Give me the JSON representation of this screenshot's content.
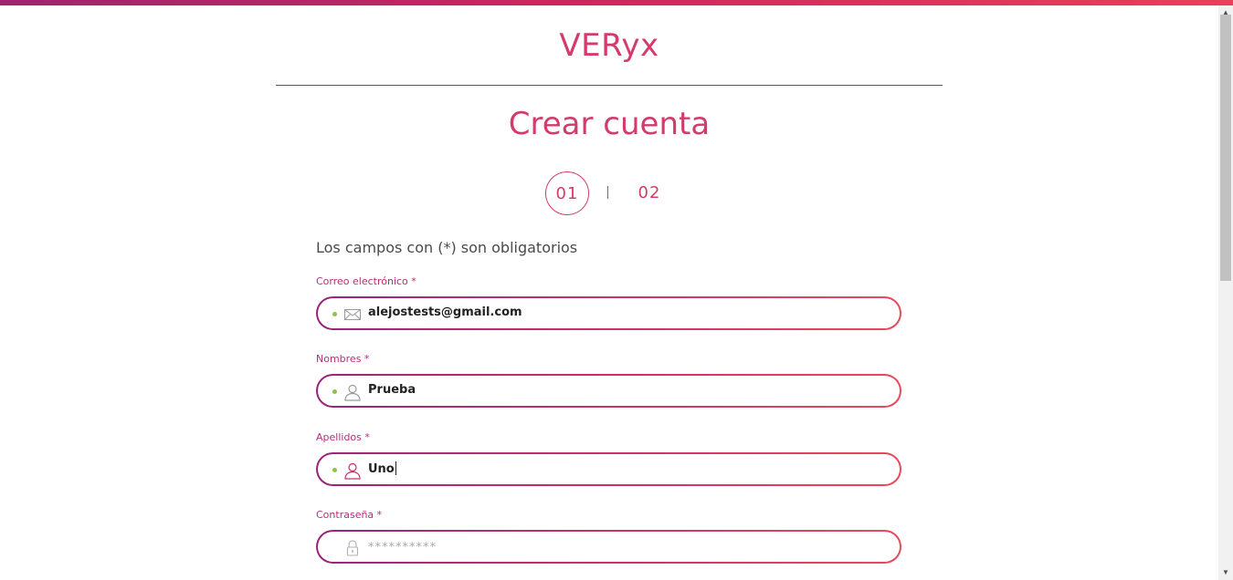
{
  "header": {
    "brand": "VERyx"
  },
  "page": {
    "title": "Crear cuenta",
    "required_note": "Los campos con (*) son obligatorios"
  },
  "steps": {
    "step1": "01",
    "step2": "02"
  },
  "form": {
    "email": {
      "label": "Correo electrónico *",
      "value": "alejostests@gmail.com",
      "icon": "envelope-icon"
    },
    "first_name": {
      "label": "Nombres *",
      "value": "Prueba",
      "icon": "user-icon"
    },
    "last_name": {
      "label": "Apellidos *",
      "value": "Uno",
      "icon": "user-icon"
    },
    "password": {
      "label": "Contraseña *",
      "placeholder": "**********",
      "icon": "lock-icon"
    }
  },
  "colors": {
    "accent": "#d43a6a",
    "label": "#b0307a",
    "valid": "#8bc34a"
  }
}
